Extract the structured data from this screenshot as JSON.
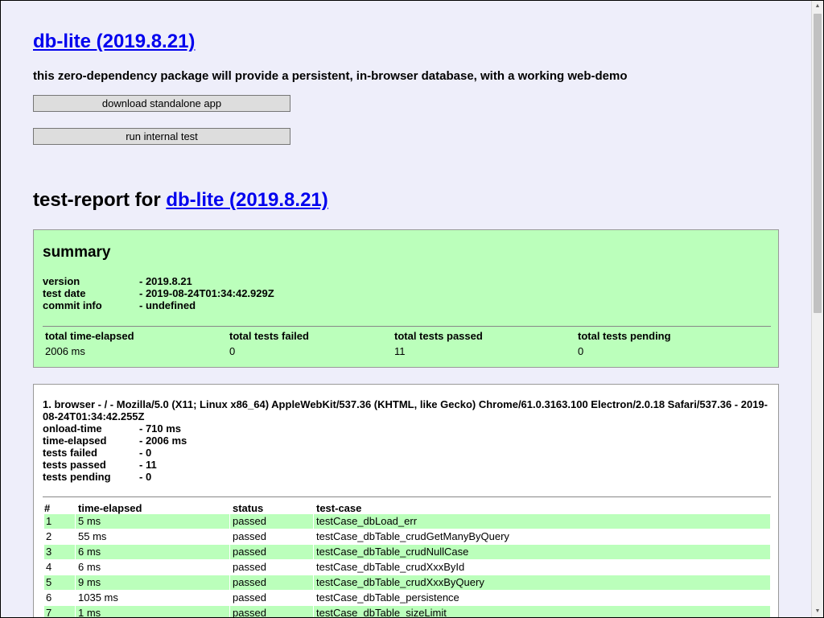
{
  "header": {
    "title": "db-lite (2019.8.21)",
    "description": "this zero-dependency package will provide a persistent, in-browser database, with a working web-demo"
  },
  "buttons": {
    "download": "download standalone app",
    "run_test": "run internal test"
  },
  "report": {
    "title_prefix": "test-report for",
    "title_link": "db-lite (2019.8.21)"
  },
  "summary": {
    "heading": "summary",
    "version_label": "version",
    "version_value": "- 2019.8.21",
    "date_label": "test date",
    "date_value": "- 2019-08-24T01:34:42.929Z",
    "commit_label": "commit info",
    "commit_value": "- undefined",
    "totals": {
      "elapsed_label": "total time-elapsed",
      "elapsed_value": "2006 ms",
      "failed_label": "total tests failed",
      "failed_value": "0",
      "passed_label": "total tests passed",
      "passed_value": "11",
      "pending_label": "total tests pending",
      "pending_value": "0"
    }
  },
  "browser": {
    "title": "1. browser - / - Mozilla/5.0 (X11; Linux x86_64) AppleWebKit/537.36 (KHTML, like Gecko) Chrome/61.0.3163.100 Electron/2.0.18 Safari/537.36 - 2019-08-24T01:34:42.255Z",
    "onload_label": "onload-time",
    "onload_value": "- 710 ms",
    "elapsed_label": "time-elapsed",
    "elapsed_value": "- 2006 ms",
    "failed_label": "tests failed",
    "failed_value": "- 0",
    "passed_label": "tests passed",
    "passed_value": "- 11",
    "pending_label": "tests pending",
    "pending_value": "- 0"
  },
  "testcases": {
    "headers": [
      "#",
      "time-elapsed",
      "status",
      "test-case"
    ],
    "rows": [
      [
        "1",
        "5 ms",
        "passed",
        "testCase_dbLoad_err"
      ],
      [
        "2",
        "55 ms",
        "passed",
        "testCase_dbTable_crudGetManyByQuery"
      ],
      [
        "3",
        "6 ms",
        "passed",
        "testCase_dbTable_crudNullCase"
      ],
      [
        "4",
        "6 ms",
        "passed",
        "testCase_dbTable_crudXxxById"
      ],
      [
        "5",
        "9 ms",
        "passed",
        "testCase_dbTable_crudXxxByQuery"
      ],
      [
        "6",
        "1035 ms",
        "passed",
        "testCase_dbTable_persistence"
      ],
      [
        "7",
        "1 ms",
        "passed",
        "testCase_dbTable_sizeLimit"
      ]
    ]
  },
  "colors": {
    "page_bg": "#eeeefa",
    "summary_bg": "#bbffbb",
    "link": "#0000ee"
  }
}
